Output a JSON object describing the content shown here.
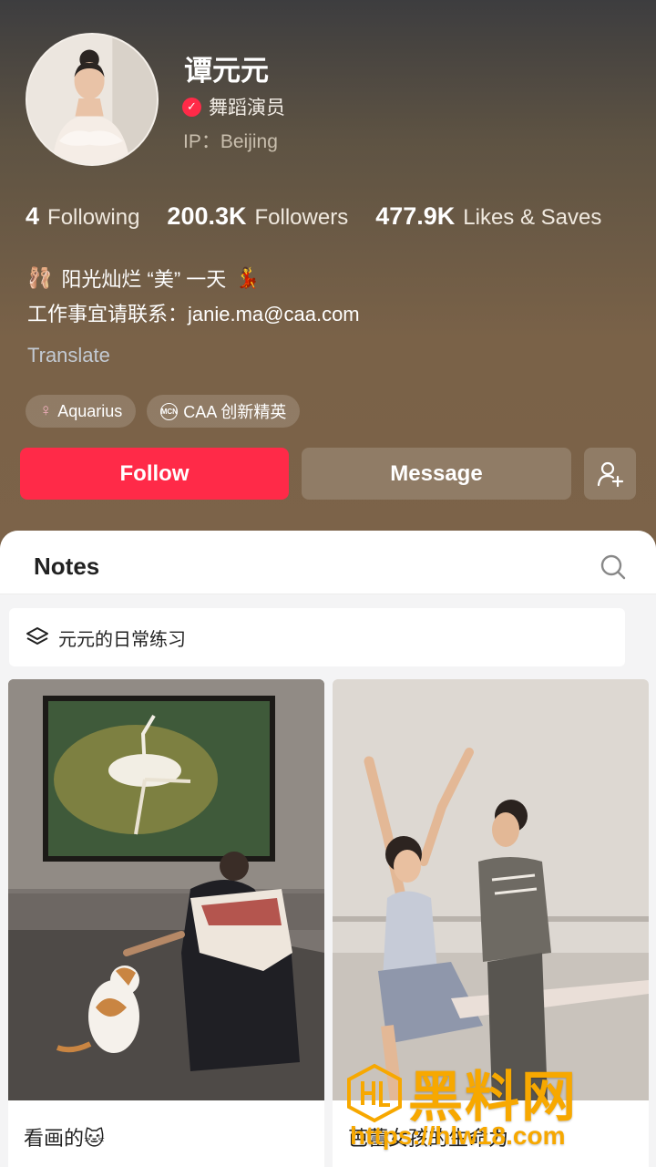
{
  "profile": {
    "name": "谭元元",
    "verified_title": "舞蹈演员",
    "ip": "IP：Beijing",
    "avatar_icon": "portrait-avatar"
  },
  "stats": [
    {
      "number": "4",
      "label": "Following"
    },
    {
      "number": "200.3K",
      "label": "Followers"
    },
    {
      "number": "477.9K",
      "label": "Likes & Saves"
    }
  ],
  "bio": {
    "line1_emoji_left": "🩰",
    "line1": "阳光灿烂 “美” 一天",
    "line1_emoji_right": "💃",
    "line2": "工作事宜请联系：janie.ma@caa.com"
  },
  "translate_label": "Translate",
  "tags": [
    {
      "icon": "female-symbol",
      "symbol": "♀",
      "label": "Aquarius"
    },
    {
      "icon": "mcn-badge",
      "symbol": "MCN",
      "label": "CAA 创新精英"
    }
  ],
  "buttons": {
    "follow": "Follow",
    "message": "Message",
    "add_friend_icon": "add-user-icon"
  },
  "colors": {
    "accent": "#ff2a48",
    "watermark": "#f7a800"
  },
  "notes": {
    "tab_label": "Notes",
    "collection_label": "元元的日常练习",
    "cards": [
      {
        "title": "看画的🐱"
      },
      {
        "title": "芭蕾女孩的生命力"
      }
    ]
  },
  "watermark": {
    "text": "黑料网",
    "url": "https://hlw18.com"
  }
}
